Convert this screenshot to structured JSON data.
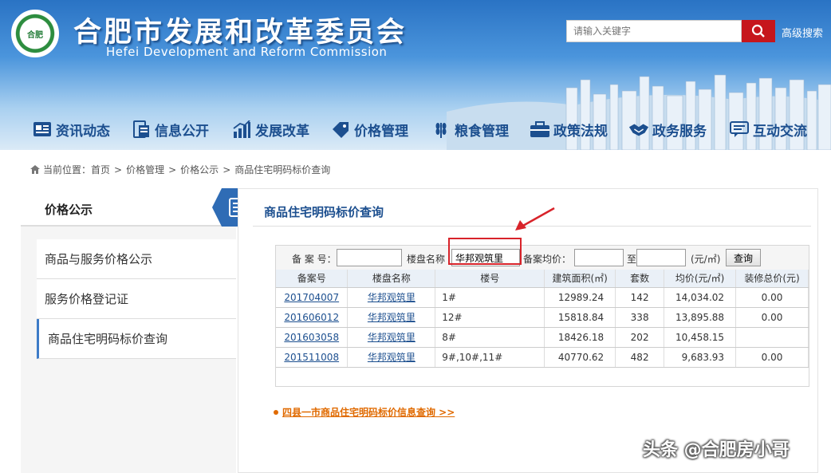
{
  "header": {
    "title": "合肥市发展和改革委员会",
    "subtitle": "Hefei Development and Reform Commission",
    "logo_text": "合肥",
    "search_placeholder": "请输入关键字",
    "advanced_search": "高级搜索"
  },
  "nav": {
    "items": [
      {
        "label": "资讯动态",
        "icon": "news-icon"
      },
      {
        "label": "信息公开",
        "icon": "document-icon"
      },
      {
        "label": "发展改革",
        "icon": "bar-chart-icon"
      },
      {
        "label": "价格管理",
        "icon": "price-tag-icon"
      },
      {
        "label": "粮食管理",
        "icon": "wheat-icon"
      },
      {
        "label": "政策法规",
        "icon": "briefcase-icon"
      },
      {
        "label": "政务服务",
        "icon": "handshake-icon"
      },
      {
        "label": "互动交流",
        "icon": "chat-icon"
      }
    ]
  },
  "breadcrumb": {
    "prefix": "当前位置：",
    "items": [
      "首页",
      "价格管理",
      "价格公示",
      "商品住宅明码标价查询"
    ],
    "separator": ">"
  },
  "sidebar": {
    "title": "价格公示",
    "items": [
      {
        "label": "商品与服务价格公示",
        "active": false
      },
      {
        "label": "服务价格登记证",
        "active": false
      },
      {
        "label": "商品住宅明码标价查询",
        "active": true
      }
    ]
  },
  "main": {
    "title": "商品住宅明码标价查询",
    "query": {
      "record_no_label": "备 案 号：",
      "record_no_value": "",
      "project_label": "楼盘名称",
      "project_value": "华邦观筑里",
      "avg_price_label": "备案均价：",
      "avg_from": "",
      "to_label": "至",
      "avg_to": "",
      "unit_label": "(元/㎡)",
      "button": "查询"
    },
    "table": {
      "headers": [
        "备案号",
        "楼盘名称",
        "楼号",
        "建筑面积(㎡)",
        "套数",
        "均价(元/㎡)",
        "装修总价(元)"
      ],
      "rows": [
        [
          "201704007",
          "华邦观筑里",
          "1#",
          "12989.24",
          "142",
          "14,034.02",
          "0.00"
        ],
        [
          "201606012",
          "华邦观筑里",
          "12#",
          "15818.84",
          "338",
          "13,895.88",
          "0.00"
        ],
        [
          "201603058",
          "华邦观筑里",
          "8#",
          "18426.18",
          "202",
          "10,458.15",
          ""
        ],
        [
          "201511008",
          "华邦观筑里",
          "9#,10#,11#",
          "40770.62",
          "482",
          "9,683.93",
          "0.00"
        ]
      ]
    },
    "more_link": "四县一市商品住宅明码标价信息查询 >>"
  },
  "watermark": "头条 @合肥房小哥",
  "colors": {
    "header_blue": "#2a73c4",
    "nav_text": "#1c4f8f",
    "search_red": "#c6161c",
    "link_orange": "#e06a00",
    "annotation_red": "#d8232a"
  }
}
